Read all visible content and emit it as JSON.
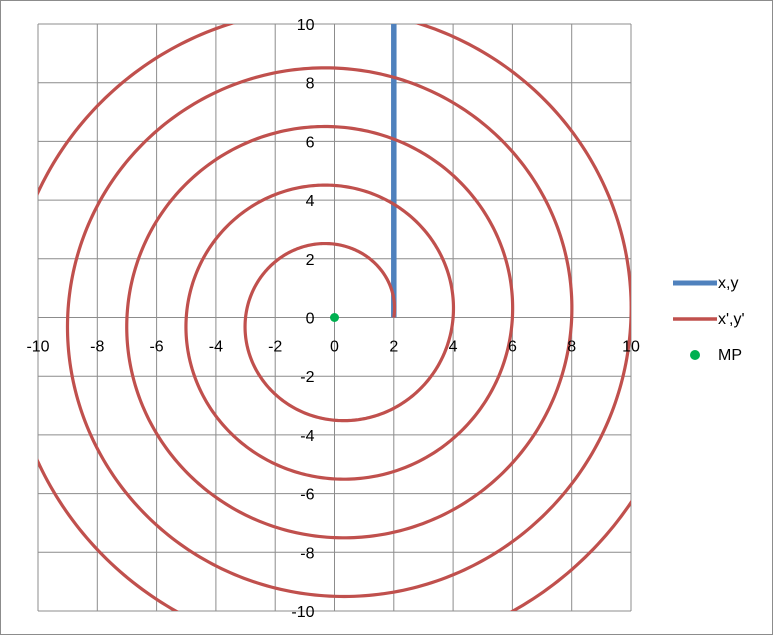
{
  "chart_data": {
    "type": "scatter",
    "xlim": [
      -10,
      10
    ],
    "ylim": [
      -10,
      10
    ],
    "x_ticks": [
      -10,
      -8,
      -6,
      -4,
      -2,
      0,
      2,
      4,
      6,
      8,
      10
    ],
    "y_ticks": [
      -10,
      -8,
      -6,
      -4,
      -2,
      0,
      2,
      4,
      6,
      8,
      10
    ],
    "x_tick_labels": [
      "-10",
      "-8",
      "-6",
      "-4",
      "-2",
      "0",
      "2",
      "4",
      "6",
      "8",
      "10"
    ],
    "y_tick_labels": [
      "-10",
      "-8",
      "-6",
      "-4",
      "-2",
      "0",
      "2",
      "4",
      "6",
      "8",
      "10"
    ],
    "grid": true,
    "legend_position": "right",
    "series": [
      {
        "name": "x,y",
        "kind": "line",
        "color": "#4f81bd",
        "points": [
          [
            2,
            0
          ],
          [
            2,
            10
          ]
        ]
      },
      {
        "name": "x',y'",
        "kind": "spiral",
        "color": "#c0504d",
        "center": [
          0,
          0
        ],
        "start_point": [
          2,
          0
        ],
        "start_radius": 2,
        "radius_growth_per_turn": 2,
        "turns": 5,
        "direction": "counterclockwise"
      },
      {
        "name": "MP",
        "kind": "marker",
        "color": "#00b050",
        "points": [
          [
            0,
            0
          ]
        ]
      }
    ]
  }
}
